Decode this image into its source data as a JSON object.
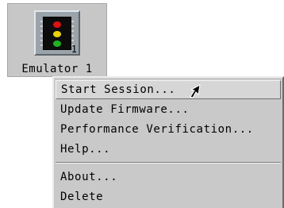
{
  "emulator": {
    "label": "Emulator 1",
    "badge_number": "1",
    "icon": "traffic-light-chip-icon",
    "light_colors": [
      "#e01010",
      "#e8d400",
      "#1fb41f"
    ]
  },
  "context_menu": {
    "items": [
      {
        "label": "Start Session...",
        "active": true
      },
      {
        "label": "Update Firmware..."
      },
      {
        "label": "Performance Verification..."
      },
      {
        "label": "Help..."
      },
      {
        "label": "About..."
      },
      {
        "label": "Delete"
      }
    ]
  },
  "cursor": {
    "icon": "arrow-cursor-icon"
  }
}
